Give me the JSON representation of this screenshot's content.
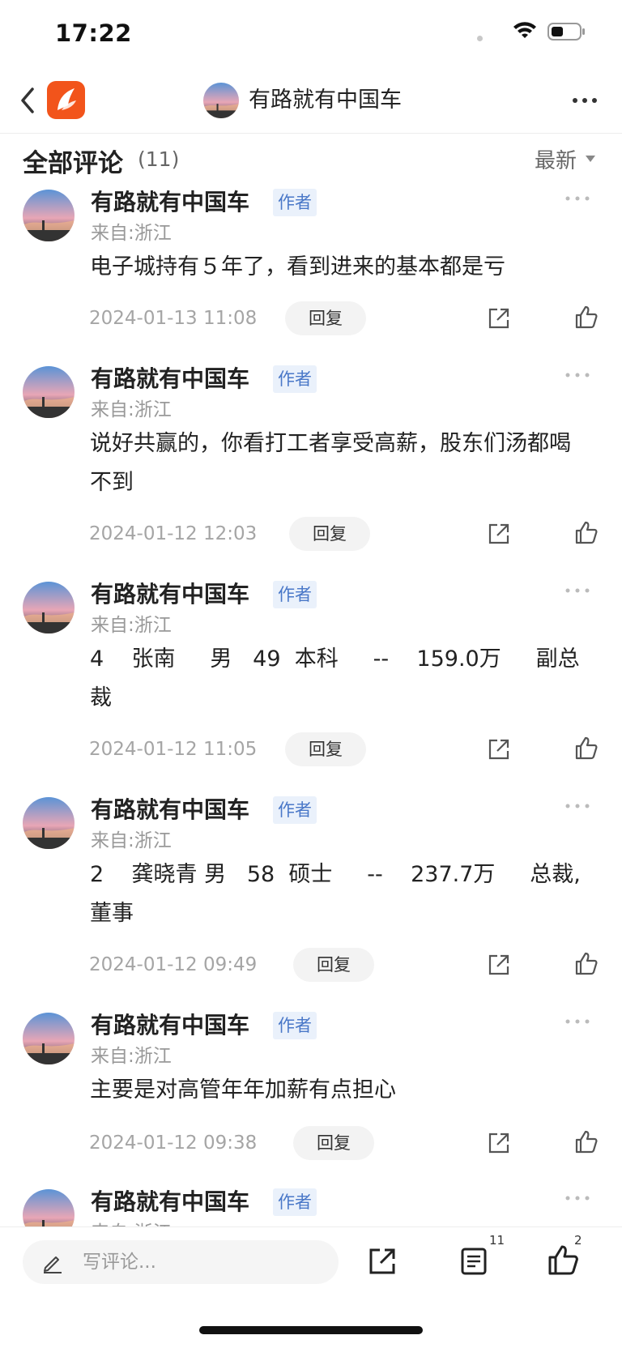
{
  "status_bar": {
    "time": "17:22"
  },
  "nav": {
    "title": "有路就有中国车"
  },
  "header": {
    "title": "全部评论",
    "count": "(11)",
    "sort_label": "最新"
  },
  "comments": [
    {
      "author": "有路就有中国车",
      "badge": "作者",
      "location": "来自:浙江",
      "text": "电子城持有５年了，看到进来的基本都是亏",
      "time": "2024-01-13 11:08",
      "reply": "回复"
    },
    {
      "author": "有路就有中国车",
      "badge": "作者",
      "location": "来自:浙江",
      "text": "说好共赢的，你看打工者享受高薪，股东们汤都喝不到",
      "time": "2024-01-12 12:03",
      "reply": "回复"
    },
    {
      "author": "有路就有中国车",
      "badge": "作者",
      "location": "来自:浙江",
      "text": "4    张南     男   49  本科     --    159.0万     副总裁",
      "time": "2024-01-12 11:05",
      "reply": "回复"
    },
    {
      "author": "有路就有中国车",
      "badge": "作者",
      "location": "来自:浙江",
      "text": "2    龚晓青 男   58  硕士     --    237.7万     总裁,董事",
      "time": "2024-01-12 09:49",
      "reply": "回复"
    },
    {
      "author": "有路就有中国车",
      "badge": "作者",
      "location": "来自:浙江",
      "text": "主要是对高管年年加薪有点担心",
      "time": "2024-01-12 09:38",
      "reply": "回复"
    },
    {
      "author": "有路就有中国车",
      "badge": "作者",
      "location": "来自:浙江",
      "text": "",
      "time": "",
      "reply": ""
    }
  ],
  "bottom_bar": {
    "placeholder": "写评论...",
    "comments_count": "11",
    "like_count": "2"
  },
  "colors": {
    "brand_orange": "#f2541b",
    "badge_blue": "#4a78c8",
    "badge_bg": "#eaf1fb"
  },
  "icons": [
    "back-icon",
    "app-logo",
    "more-icon",
    "share-icon",
    "like-icon",
    "pencil-icon",
    "comments-list-icon",
    "wifi-icon",
    "battery-icon"
  ]
}
